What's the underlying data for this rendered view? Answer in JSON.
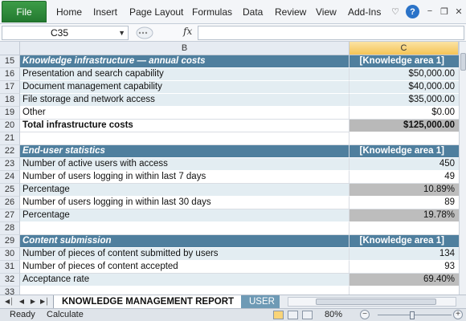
{
  "ribbon": {
    "file": "File",
    "tabs": [
      "Home",
      "Insert",
      "Page Layout",
      "Formulas",
      "Data",
      "Review",
      "View",
      "Add-Ins"
    ]
  },
  "formula_bar": {
    "name_box": "C35",
    "fx": "fx",
    "value": ""
  },
  "columns": {
    "b": "B",
    "c": "C"
  },
  "rows": [
    {
      "n": "15",
      "type": "header",
      "b": "Knowledge infrastructure — annual costs",
      "c": "[Knowledge area 1]"
    },
    {
      "n": "16",
      "type": "item",
      "b": "Presentation and search capability",
      "c": "$50,000.00"
    },
    {
      "n": "17",
      "type": "item",
      "b": "Document management capability",
      "c": "$40,000.00"
    },
    {
      "n": "18",
      "type": "item",
      "b": "File storage and network access",
      "c": "$35,000.00"
    },
    {
      "n": "19",
      "type": "plain",
      "b": "Other",
      "c": "$0.00"
    },
    {
      "n": "20",
      "type": "total",
      "b": "Total infrastructure costs",
      "c": "$125,000.00"
    },
    {
      "n": "21",
      "type": "blank",
      "b": "",
      "c": ""
    },
    {
      "n": "22",
      "type": "header",
      "b": "End-user statistics",
      "c": "[Knowledge area 1]"
    },
    {
      "n": "23",
      "type": "item",
      "b": "Number of active users with access",
      "c": "450"
    },
    {
      "n": "24",
      "type": "plain",
      "b": "Number of users logging in within last 7 days",
      "c": "49"
    },
    {
      "n": "25",
      "type": "item pct",
      "b": "Percentage",
      "c": "10.89%"
    },
    {
      "n": "26",
      "type": "plain",
      "b": "Number of users logging in within last 30 days",
      "c": "89"
    },
    {
      "n": "27",
      "type": "item pct",
      "b": "Percentage",
      "c": "19.78%"
    },
    {
      "n": "28",
      "type": "blank",
      "b": "",
      "c": ""
    },
    {
      "n": "29",
      "type": "header",
      "b": "Content submission",
      "c": "[Knowledge area 1]"
    },
    {
      "n": "30",
      "type": "item",
      "b": "Number of pieces of content submitted by users",
      "c": "134"
    },
    {
      "n": "31",
      "type": "plain",
      "b": "Number of pieces of content accepted",
      "c": "93"
    },
    {
      "n": "32",
      "type": "item pct",
      "b": "Acceptance rate",
      "c": "69.40%"
    },
    {
      "n": "33",
      "type": "blank",
      "b": "",
      "c": ""
    }
  ],
  "sheet_tabs": {
    "active": "KNOWLEDGE MANAGEMENT REPORT",
    "inactive": "USER"
  },
  "status_bar": {
    "ready": "Ready",
    "calculate": "Calculate",
    "zoom": "80%"
  },
  "colors": {
    "section_header": "#4f7f9e",
    "item_fill": "#e3edf2",
    "total_fill": "#b9b9b9",
    "file_tab": "#2f8a3c"
  }
}
